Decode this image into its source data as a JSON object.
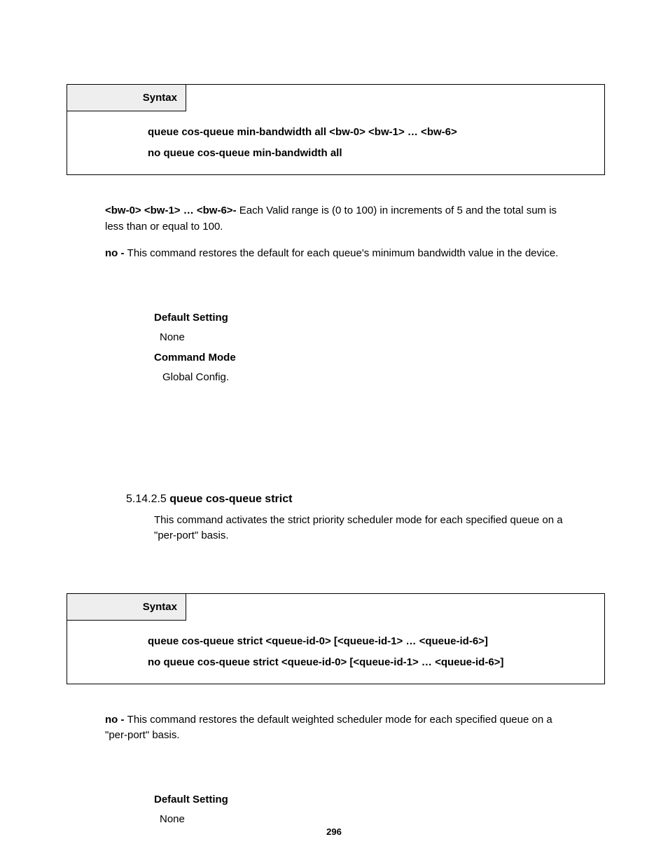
{
  "syntax1": {
    "label": "Syntax",
    "line1": "queue cos-queue min-bandwidth all <bw-0> <bw-1> … <bw-6>",
    "line2": "no queue cos-queue min-bandwidth all"
  },
  "block1": {
    "p1_bold": "<bw-0> <bw-1> … <bw-6>- ",
    "p1_rest": "Each Valid range is (0 to 100) in increments of 5 and the total sum is less than or equal to 100.",
    "p2_bold": "no - ",
    "p2_rest": "This command restores the default for each queue's minimum bandwidth value in the device."
  },
  "defaults1": {
    "ds_label": "Default Setting",
    "ds_value": "None",
    "cm_label": "Command Mode",
    "cm_value": "Global Config."
  },
  "section": {
    "num": "5.14.2.5 ",
    "title": "queue cos-queue strict",
    "intro": "This command activates the strict priority scheduler mode for each specified queue on a \"per-port\" basis."
  },
  "syntax2": {
    "label": "Syntax",
    "line1": "queue cos-queue strict <queue-id-0> [<queue-id-1> … <queue-id-6>]",
    "line2": "no queue cos-queue strict <queue-id-0> [<queue-id-1> … <queue-id-6>]"
  },
  "block2": {
    "p1_bold": "no - ",
    "p1_rest": "This command restores the default weighted scheduler mode for each specified queue on a \"per-port\" basis."
  },
  "defaults2": {
    "ds_label": "Default Setting",
    "ds_value": "None"
  },
  "page_num": "296"
}
